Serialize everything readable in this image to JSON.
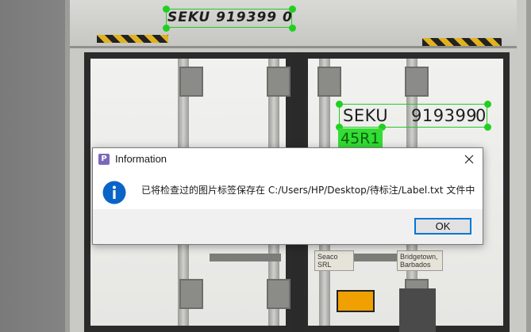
{
  "photo": {
    "top_code": "SEKU 919399 0",
    "right_code_prefix": "SEKU",
    "right_code_number": "919399",
    "right_code_check": "0",
    "badge_text": "45R1",
    "plate_left": [
      "Seaco",
      "SRL"
    ],
    "plate_right": [
      "Bridgetown,",
      "Barbados"
    ]
  },
  "dialog": {
    "title": "Information",
    "app_icon_letter": "P",
    "message": "已将检查过的图片标签保存在 C:/Users/HP/Desktop/待标注/Label.txt 文件中",
    "ok_label": "OK"
  },
  "colors": {
    "annotation": "#22cc22",
    "info_icon": "#0a64c8",
    "ok_border": "#0078d7"
  },
  "icons": {
    "app": "app-icon",
    "info": "info-icon",
    "close": "close-icon"
  }
}
